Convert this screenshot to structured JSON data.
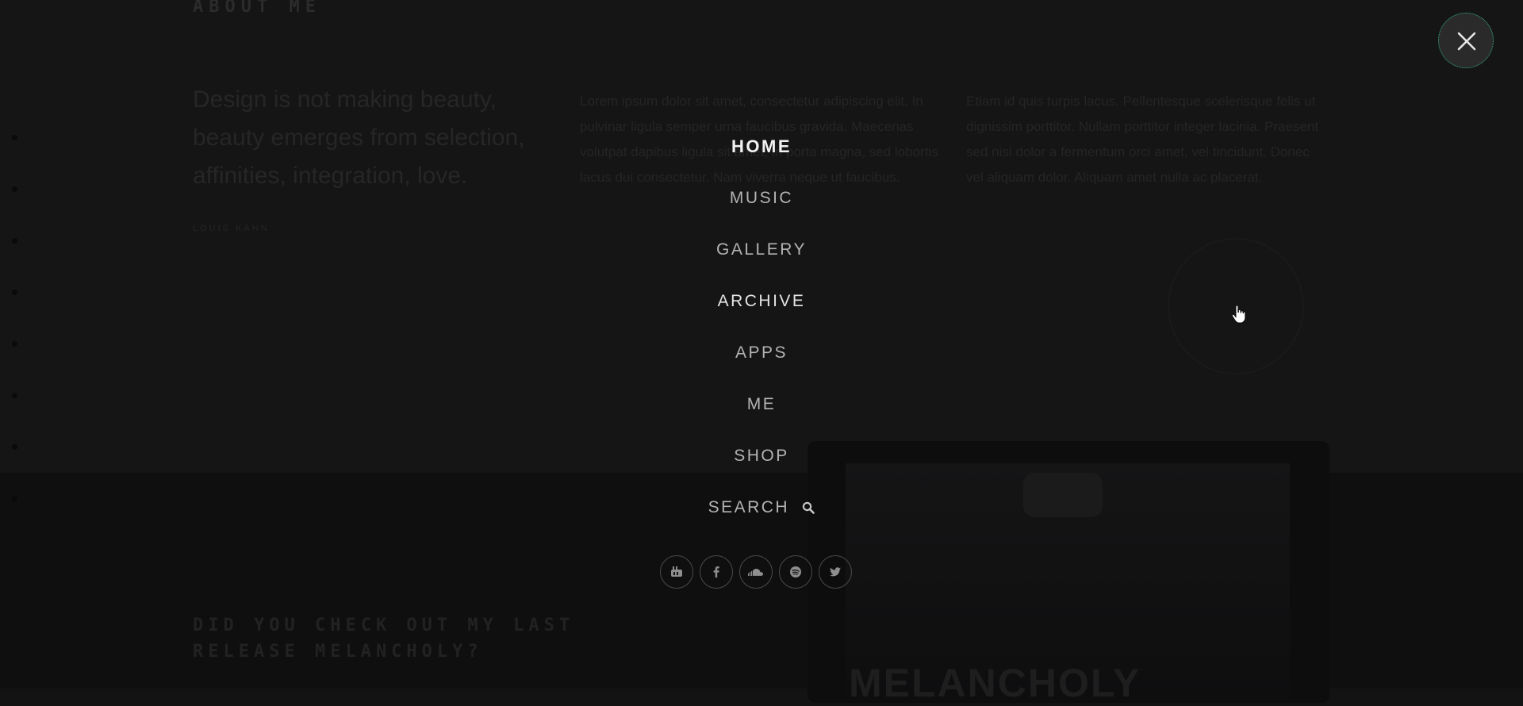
{
  "background": {
    "about_title": "ABOUT ME",
    "quote": "Design is not making beauty, beauty emerges from selection, affinities, integration, love.",
    "quote_author": "LOUIS KAHN",
    "lorem_col1": "Lorem ipsum dolor sit amet, consectetur adipiscing elit. In pulvinar ligula semper urna faucibus gravida. Maecenas volutpat dapibus ligula sit amet, in porta magna, sed lobortis lacus dui consectetur. Nam viverra neque ut faucibus.",
    "lorem_col2": "Etiam id quis turpis lacus. Pellentesque scelerisque felis ut dignissim porttitor. Nullam porttitor integer lacinia. Praesent sed nisi dolor a fermentum orci amet, vel tincidunt. Donec vel aliquam dolor. Aliquam amet nulla ac placerat.",
    "release_heading": "DID YOU CHECK OUT MY LAST RELEASE MELANCHOLY?",
    "release_art_text": "MELANCHOLY"
  },
  "menu": {
    "items": [
      {
        "label": "HOME"
      },
      {
        "label": "MUSIC"
      },
      {
        "label": "GALLERY"
      },
      {
        "label": "ARCHIVE"
      },
      {
        "label": "APPS"
      },
      {
        "label": "ME"
      },
      {
        "label": "SHOP"
      },
      {
        "label": "SEARCH"
      }
    ],
    "active_item": "HOME",
    "hovered_item": "ARCHIVE"
  },
  "social": [
    {
      "icon": "youtube-icon"
    },
    {
      "icon": "facebook-icon"
    },
    {
      "icon": "soundcloud-icon"
    },
    {
      "icon": "spotify-icon"
    },
    {
      "icon": "twitter-icon"
    }
  ],
  "icons": {
    "close": "close-icon",
    "search": "search-icon",
    "cursor": "hand-cursor-icon"
  },
  "colors": {
    "overlay_bg": "#131314",
    "menu_text": "#b3b3b3",
    "menu_active": "#f2f2f2",
    "close_border_accent": "#2fae7a"
  }
}
